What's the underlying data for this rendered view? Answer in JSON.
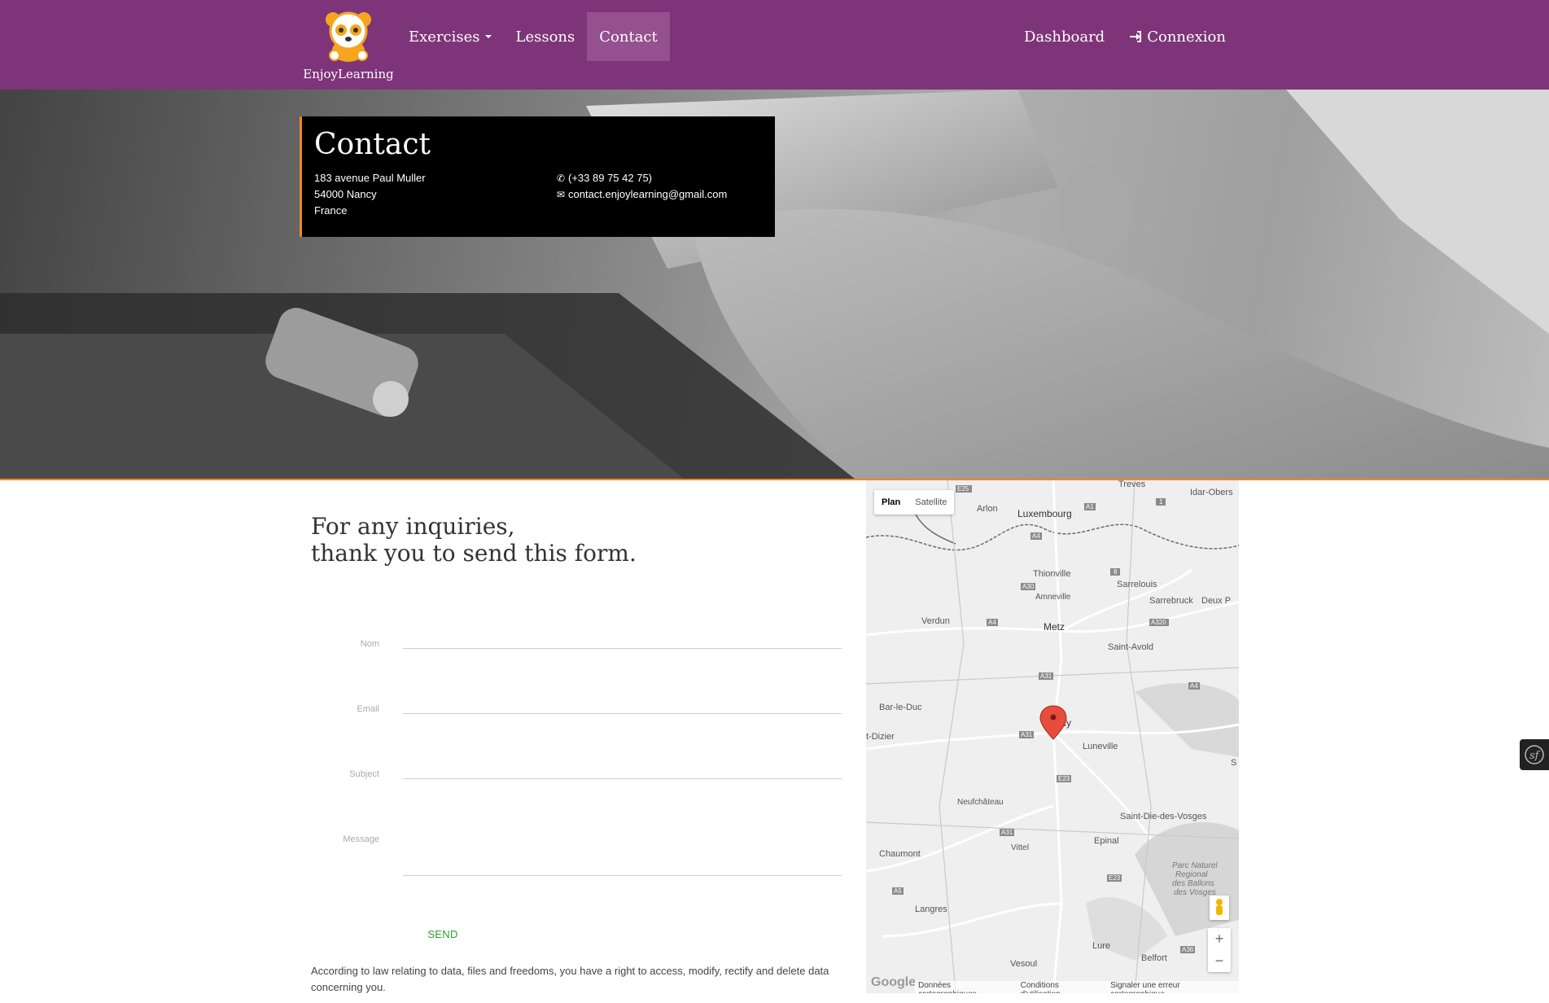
{
  "brand": {
    "name": "EnjoyLearning",
    "logo_icon": "panda-logo-icon"
  },
  "nav": {
    "left": [
      {
        "label": "Exercises",
        "dropdown": true
      },
      {
        "label": "Lessons"
      },
      {
        "label": "Contact",
        "active": true
      }
    ],
    "right": [
      {
        "label": "Dashboard"
      },
      {
        "label": "Connexion",
        "icon": "sign-in-icon"
      }
    ]
  },
  "contact": {
    "title": "Contact",
    "address": [
      "183 avenue Paul Muller",
      "54000 Nancy",
      "France"
    ],
    "phone": "(+33 89 75 42 75)",
    "email": "contact.enjoylearning@gmail.com"
  },
  "form": {
    "heading_line1": "For any inquiries,",
    "heading_line2": "thank you to send this form.",
    "fields": [
      {
        "label": "Nom"
      },
      {
        "label": "Email"
      },
      {
        "label": "Subject"
      },
      {
        "label": "Message"
      }
    ],
    "submit": "SEND",
    "legal": "According to law relating to data, files and freedoms, you have a right to access, modify, rectify and delete data concerning you."
  },
  "map": {
    "type_buttons": [
      "Plan",
      "Satellite"
    ],
    "active_type": "Plan",
    "zoom_in": "+",
    "zoom_out": "−",
    "logo": "Google",
    "footer": [
      "Données cartographiques",
      "Conditions d'utilisation",
      "Signaler une erreur cartographique"
    ],
    "places": [
      "Treves",
      "Idar-Obers",
      "Arlon",
      "Luxembourg",
      "Thionville",
      "Amneville",
      "Sarrelouis",
      "Sarrebruck",
      "Deux P",
      "Verdun",
      "Metz",
      "Saint-Avold",
      "Bar-le-Duc",
      "Nancy",
      "t-Dizier",
      "Luneville",
      "Neufchâteau",
      "Saint-Die-des-Vosges",
      "Epinal",
      "Chaumont",
      "Vittel",
      "Parc Naturel",
      "Regional",
      "des Ballons",
      "des Vosges",
      "Langres",
      "Lure",
      "Belfort",
      "Vesoul",
      "S"
    ],
    "road_shields": [
      "E25",
      "A1",
      "A4",
      "A30",
      "8",
      "A320",
      "A4",
      "A31",
      "A4",
      "A31",
      "E23",
      "A31",
      "E23",
      "A5",
      "A36",
      "1"
    ]
  },
  "colors": {
    "navbar": "#7e3479",
    "accent": "#f0862a",
    "send": "#29a02c"
  }
}
